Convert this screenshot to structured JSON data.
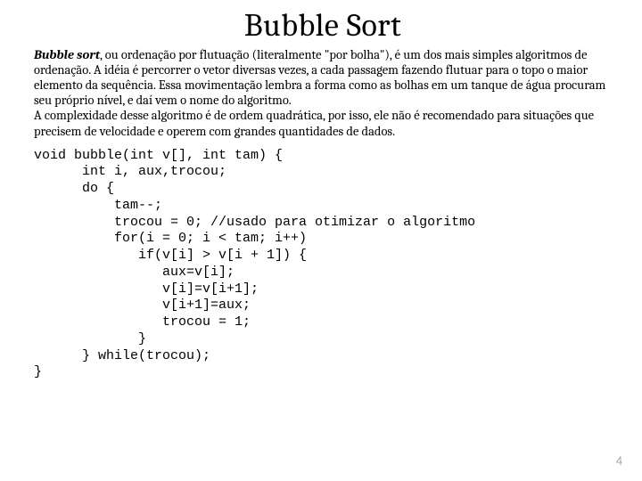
{
  "title": "Bubble Sort",
  "para": {
    "lead_bold": "Bubble sort",
    "p1": ", ou ordenação por flutuação (literalmente \"por bolha\"), é um dos mais simples algoritmos de ordenação. A idéia é percorrer o vetor diversas vezes, a cada passagem fazendo flutuar para o topo o maior elemento da sequência. Essa movimentação lembra a forma como as bolhas em um tanque de água procuram seu próprio nível, e daí vem o nome do algoritmo.",
    "p2": "A complexidade desse algoritmo é de ordem quadrática, por isso, ele não é recomendado para situações que precisem de velocidade e operem com grandes quantidades de dados."
  },
  "code": "void bubble(int v[], int tam) {\n      int i, aux,trocou;\n      do {\n          tam--;\n          trocou = 0; //usado para otimizar o algoritmo\n          for(i = 0; i < tam; i++)\n             if(v[i] > v[i + 1]) {\n                aux=v[i];\n                v[i]=v[i+1];\n                v[i+1]=aux;\n                trocou = 1;\n             }\n      } while(trocou);\n}",
  "page_number": "4"
}
